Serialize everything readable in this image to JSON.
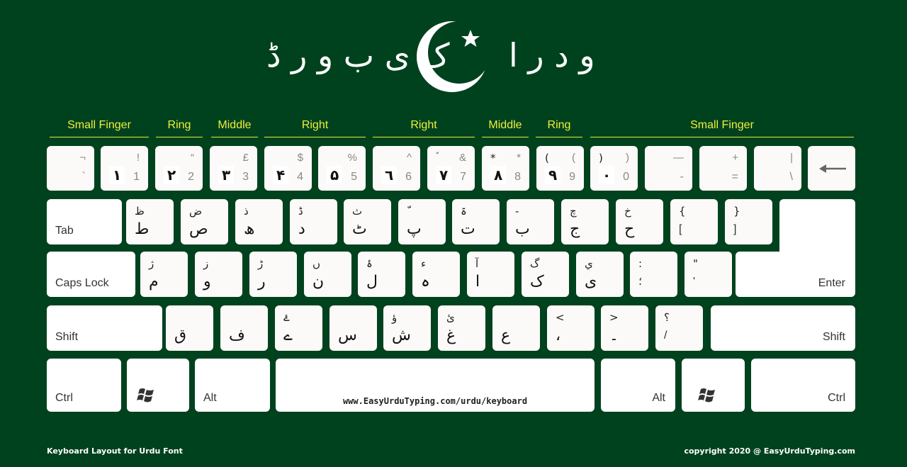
{
  "header": {
    "title_left": "ک ی ب و ر ڈ",
    "title_right": "و د ر ا",
    "emblem": "crescent-star-icon"
  },
  "fingers": [
    {
      "label": "Small Finger"
    },
    {
      "label": "Ring"
    },
    {
      "label": "Middle"
    },
    {
      "label": "Right"
    },
    {
      "label": "Right"
    },
    {
      "label": "Middle"
    },
    {
      "label": "Ring"
    },
    {
      "label": "Small Finger"
    }
  ],
  "rows": {
    "numbers": [
      {
        "tr": "¬",
        "br": "`"
      },
      {
        "tr": "!",
        "bl": "١",
        "br": "1"
      },
      {
        "tr": "“",
        "bl": "٢",
        "br": "2"
      },
      {
        "tr": "£",
        "bl": "٣",
        "br": "3"
      },
      {
        "tr": "$",
        "bl": "۴",
        "br": "4"
      },
      {
        "tr": "%",
        "bl": "۵",
        "br": "5"
      },
      {
        "tr": "^",
        "bl": "٦",
        "br": "6"
      },
      {
        "tl": "ؐ",
        "tr": "&",
        "bl": "٧",
        "br": "7"
      },
      {
        "tl": "*",
        "tr": "*",
        "bl": "٨",
        "br": "8"
      },
      {
        "tl": "(",
        "tr": "(",
        "bl": "٩",
        "br": "9"
      },
      {
        "tl": ")",
        "tr": ")",
        "bl": "٠",
        "br": "0"
      },
      {
        "tr": "—",
        "br": "-"
      },
      {
        "tr": "+",
        "br": "="
      },
      {
        "tr": "|",
        "br": "\\"
      },
      {
        "icon": "backspace-arrow-icon"
      }
    ],
    "top": {
      "tab_label": "Tab",
      "keys": [
        {
          "tl": "ظ",
          "bl": "ط"
        },
        {
          "tl": "ض",
          "bl": "ص"
        },
        {
          "tl": "ذ",
          "bl": "ھ"
        },
        {
          "tl": "ڈ",
          "bl": "د"
        },
        {
          "tl": "ث",
          "bl": "ٹ"
        },
        {
          "tl": "ّ",
          "bl": "پ"
        },
        {
          "tl": "ۃ",
          "bl": "ت"
        },
        {
          "tl": "-",
          "bl": "ب"
        },
        {
          "tl": "چ",
          "bl": "ج"
        },
        {
          "tl": "خ",
          "bl": "ح"
        },
        {
          "tl": "{",
          "bl": "["
        },
        {
          "tl": "}",
          "bl": "]"
        }
      ]
    },
    "home": {
      "caps_label": "Caps Lock",
      "enter_label": "Enter",
      "keys": [
        {
          "tl": "ژ",
          "bl": "م"
        },
        {
          "tl": "ز",
          "bl": "و"
        },
        {
          "tl": "ڑ",
          "bl": "ر"
        },
        {
          "tl": "ں",
          "bl": "ن"
        },
        {
          "tl": "ۂ",
          "bl": "ل"
        },
        {
          "tl": "ء",
          "bl": "ہ"
        },
        {
          "tl": "آ",
          "bl": "ا"
        },
        {
          "tl": "گ",
          "bl": "ک"
        },
        {
          "tl": "ي",
          "bl": "ی"
        },
        {
          "tl": ":",
          "bl": "؛"
        },
        {
          "tl": "\"",
          "bl": "'"
        }
      ]
    },
    "bottom": {
      "shift_left_label": "Shift",
      "shift_right_label": "Shift",
      "keys": [
        {
          "bl": "ق"
        },
        {
          "bl": "ف"
        },
        {
          "tl": "ۓ",
          "bl": "ے"
        },
        {
          "bl": "س"
        },
        {
          "tl": "ؤ",
          "bl": "ش"
        },
        {
          "tl": "ئ",
          "bl": "غ"
        },
        {
          "bl": "ع"
        },
        {
          "tl": "<",
          "bl": "،"
        },
        {
          "tl": ">",
          "bl": "۔"
        },
        {
          "tl": "؟",
          "bl": "/"
        }
      ]
    },
    "space_row": {
      "ctrl_left": "Ctrl",
      "alt_left": "Alt",
      "space_url": "www.EasyUrduTyping.com/urdu/keyboard",
      "alt_right": "Alt",
      "ctrl_right": "Ctrl"
    }
  },
  "footer": {
    "left": "Keyboard Layout for Urdu Font",
    "right": "copyright 2020 @ EasyUrduTyping.com"
  },
  "colors": {
    "background": "#01421e",
    "finger_label": "#eef03a",
    "key": "#fbfaf8"
  }
}
